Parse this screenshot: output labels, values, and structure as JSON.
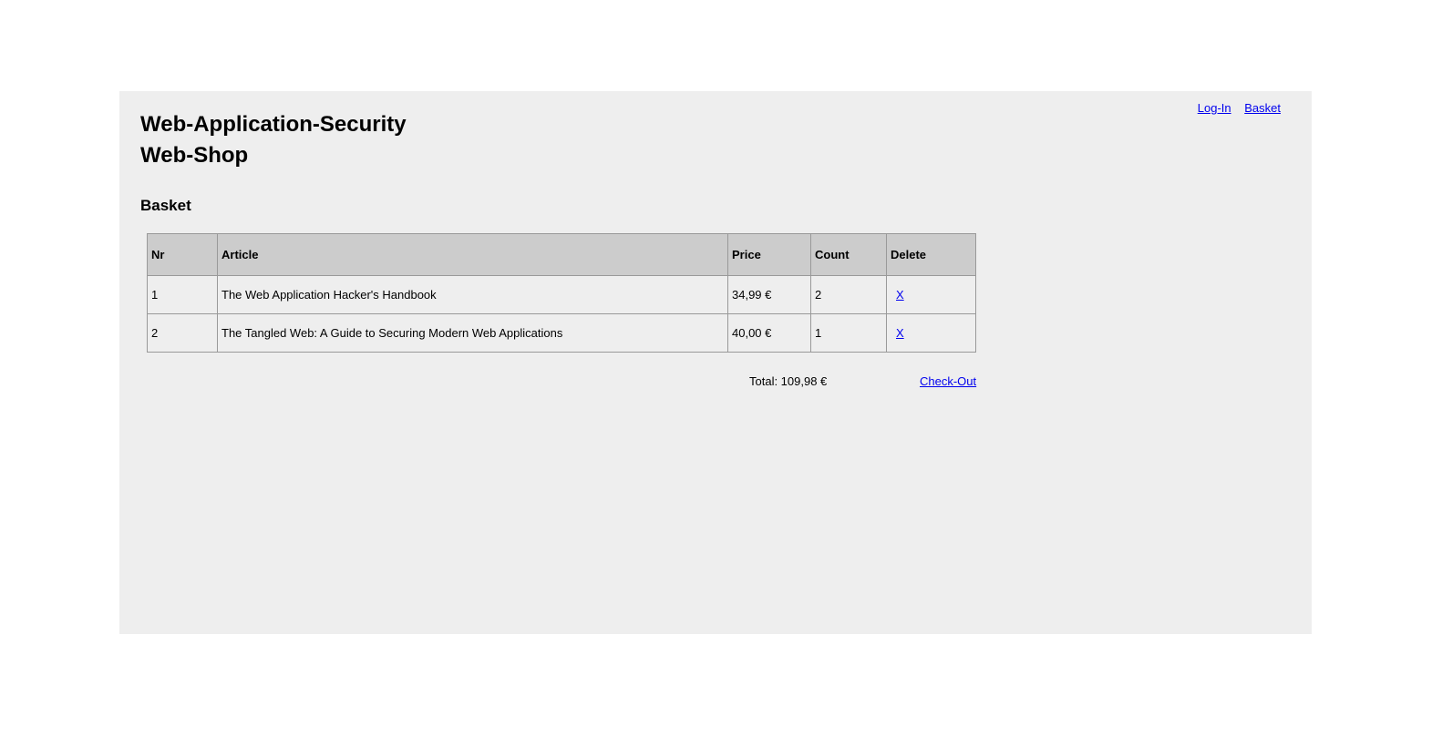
{
  "nav": {
    "login": "Log-In",
    "basket": "Basket"
  },
  "site": {
    "title_line1": "Web-Application-Security",
    "title_line2": "Web-Shop"
  },
  "section_title": "Basket",
  "table": {
    "headers": [
      "Nr",
      "Article",
      "Price",
      "Count",
      "Delete"
    ],
    "rows": [
      {
        "nr": "1",
        "article": "The Web Application Hacker's Handbook",
        "price": "34,99 €",
        "count": "2",
        "delete": "X"
      },
      {
        "nr": "2",
        "article": "The Tangled Web: A Guide to Securing Modern Web Applications",
        "price": "40,00 €",
        "count": "1",
        "delete": "X"
      }
    ]
  },
  "summary": {
    "total": "Total: 109,98 €",
    "checkout": "Check-Out"
  }
}
